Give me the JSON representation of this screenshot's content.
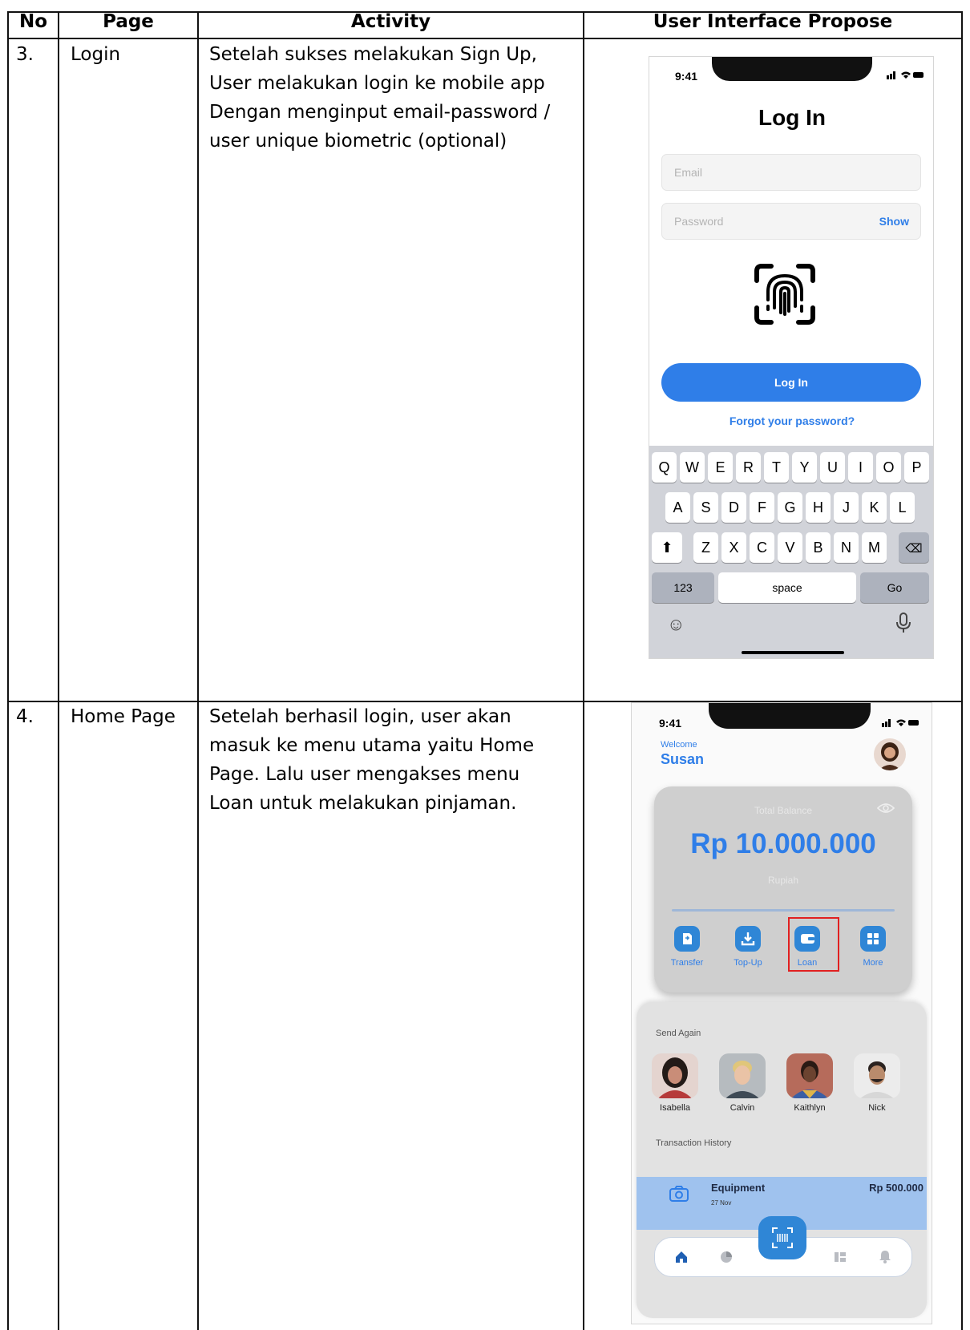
{
  "table": {
    "headers": [
      "No",
      "Page",
      "Activity",
      "User Interface Propose"
    ],
    "rows": [
      {
        "no": "3.",
        "page": "Login",
        "activity": [
          "Setelah sukses melakukan Sign Up,",
          "User melakukan login ke mobile app",
          "Dengan menginput email-password /",
          "user unique biometric (optional)"
        ]
      },
      {
        "no": "4.",
        "page": "Home Page",
        "activity": [
          "Setelah berhasil login, user akan",
          "masuk ke menu utama yaitu Home",
          "Page. Lalu user mengakses menu",
          "Loan untuk melakukan pinjaman."
        ]
      }
    ]
  },
  "login_screen": {
    "time": "9:41",
    "title": "Log In",
    "email_placeholder": "Email",
    "password_placeholder": "Password",
    "show_label": "Show",
    "login_button": "Log In",
    "forgot_link": "Forgot your password?",
    "keyboard": {
      "row1": [
        "Q",
        "W",
        "E",
        "R",
        "T",
        "Y",
        "U",
        "I",
        "O",
        "P"
      ],
      "row2": [
        "A",
        "S",
        "D",
        "F",
        "G",
        "H",
        "J",
        "K",
        "L"
      ],
      "row3": [
        "Z",
        "X",
        "C",
        "V",
        "B",
        "N",
        "M"
      ],
      "numbers_key": "123",
      "space_key": "space",
      "go_key": "Go"
    },
    "icons": [
      "fingerprint-icon",
      "shift-icon",
      "backspace-icon",
      "emoji-icon",
      "microphone-icon"
    ]
  },
  "home_screen": {
    "time": "9:41",
    "welcome": "Welcome",
    "user_name": "Susan",
    "balance_label": "Total Balance",
    "balance_amount": "Rp 10.000.000",
    "currency": "Rupiah",
    "actions": [
      "Transfer",
      "Top-Up",
      "Loan",
      "More"
    ],
    "send_again_title": "Send Again",
    "contacts": [
      "Isabella",
      "Calvin",
      "Kaithlyn",
      "Nick"
    ],
    "history_title": "Transaction History",
    "transaction": {
      "name": "Equipment",
      "date": "27 Nov",
      "amount": "Rp 500.000"
    },
    "colors": {
      "accent": "#2f7ee8",
      "card": "#cfcfcf",
      "highlight": "#e12020"
    },
    "icons": [
      "eye-icon",
      "camera-icon",
      "scan-icon",
      "home-icon",
      "chart-icon",
      "card-icon",
      "bell-icon"
    ]
  }
}
